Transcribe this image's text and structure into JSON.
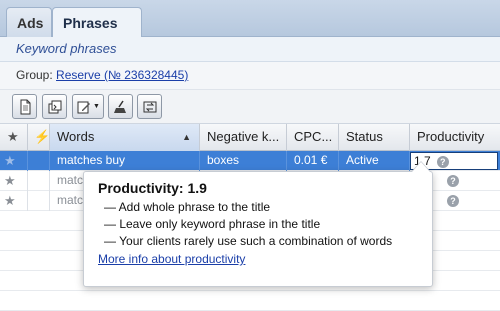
{
  "tabs": [
    {
      "label": "Ads"
    },
    {
      "label": "Phrases"
    }
  ],
  "subheader": "Keyword phrases",
  "group": {
    "label": "Group:",
    "link_text": "Reserve (№ 236328445)"
  },
  "table": {
    "columns": [
      "Words",
      "Negative k...",
      "CPC...",
      "Status",
      "Productivity"
    ],
    "rows": [
      {
        "words": "matches buy",
        "negative": "boxes",
        "cpc": "0.01 €",
        "status": "Active",
        "productivity": "1.7"
      },
      {
        "words": "matc",
        "negative": "",
        "cpc": "",
        "status": "",
        "productivity": ""
      },
      {
        "words": "matc",
        "negative": "",
        "cpc": "",
        "status": "",
        "productivity": ""
      }
    ]
  },
  "tooltip": {
    "title": "Productivity: 1.9",
    "items": [
      "— Add whole phrase to the title",
      "— Leave only keyword phrase in the title",
      "— Your clients rarely use such a combination of words"
    ],
    "link": "More info about productivity"
  },
  "colors": {
    "selected_row": "#3d7fd6",
    "link": "#1a3ea8",
    "tab_bg": "#b6c8de"
  }
}
